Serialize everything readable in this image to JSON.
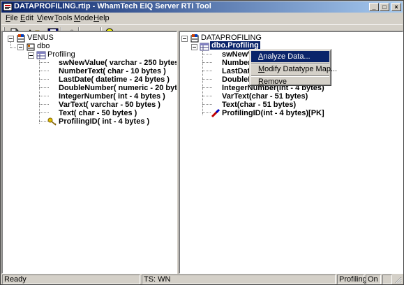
{
  "window": {
    "title": "DATAPROFILING.rtip - WhamTech EIQ Server RTI Tool"
  },
  "titlebar_buttons": {
    "minimize": "_",
    "maximize": "□",
    "close": "×"
  },
  "menu": [
    {
      "label": "File",
      "key": "F",
      "rest": "ile"
    },
    {
      "label": "Edit",
      "key": "E",
      "rest": "dit"
    },
    {
      "label": "View",
      "key": "V",
      "rest": "iew"
    },
    {
      "label": "Tools",
      "key": "T",
      "rest": "ools"
    },
    {
      "label": "Mode",
      "key": "M",
      "rest": "ode"
    },
    {
      "label": "Help",
      "key": "H",
      "rest": "elp"
    }
  ],
  "toolbar": [
    "new-file-icon",
    "edit-pencil-icon",
    "open-folder-icon",
    "save-disk-icon",
    "link-icon",
    "run-arrows-icon",
    "help-lightbulb-icon"
  ],
  "left_tree": {
    "root": "VENUS",
    "schema": "dbo",
    "table": "Profiling",
    "columns": [
      "swNewValue( varchar - 250 bytes )",
      "NumberText( char - 10 bytes )",
      "LastDate( datetime - 24 bytes )",
      "DoubleNumber( numeric - 20 bytes )",
      "IntegerNumber( int - 4 bytes )",
      "VarText( varchar - 50 bytes )",
      "Text( char - 50 bytes )",
      "ProfilingID( int - 4 bytes )"
    ]
  },
  "right_tree": {
    "root": "DATAPROFILING",
    "table": "dbo.Profiling",
    "columns": [
      "swNewVa",
      "NumberT",
      "LastDate",
      "DoubleNu",
      "IntegerNumber(int - 4 bytes)",
      "VarText(char - 51 bytes)",
      "Text(char - 51 bytes)",
      "ProfilingID(int - 4 bytes)[PK]"
    ]
  },
  "context_menu": {
    "items": [
      {
        "label": "Analyze Data...",
        "key": "A",
        "rest": "nalyze Data..."
      },
      {
        "label": "Modify Datatype Map...",
        "key": "M",
        "rest": "odify Datatype Map..."
      },
      {
        "label": "Remove",
        "key": "R",
        "rest": "emove"
      }
    ]
  },
  "status": {
    "left": "Ready",
    "middle": "TS: WN",
    "right1": "Profiling",
    "right2": "On"
  },
  "colors": {
    "selection": "#0a246a",
    "face": "#d4d0c8",
    "titlebar_start": "#0a246a",
    "titlebar_end": "#a6caf0"
  }
}
